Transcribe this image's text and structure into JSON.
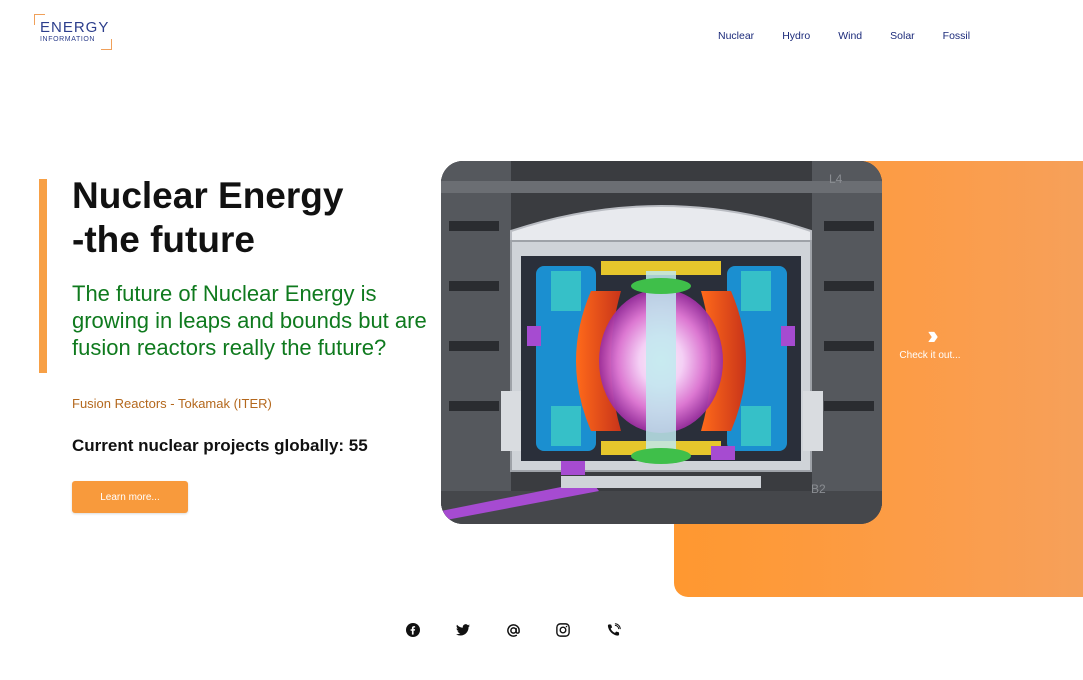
{
  "brand": {
    "line1": "ENERGY",
    "line2": "INFORMATION",
    "accent": "#f0a05a",
    "color": "#2c3e8c"
  },
  "nav": {
    "items": [
      "Nuclear",
      "Hydro",
      "Wind",
      "Solar",
      "Fossil"
    ]
  },
  "hero": {
    "title_line1": "Nuclear Energy",
    "title_line2": "-the future",
    "lead": "The future of Nuclear Energy is growing in leaps and bounds but are fusion reactors really the future?",
    "caption": "Fusion Reactors - Tokamak (ITER)",
    "projects_label": "Current nuclear projects globally: 55",
    "cta": "Learn more...",
    "check_label": "Check it out...",
    "check_icon": "double-chevron-right-icon"
  },
  "image": {
    "tag_top": "L4",
    "tag_bottom": "B2"
  },
  "colors": {
    "accent_orange": "#f89a3c",
    "lead_green": "#0f7a1e",
    "caption_brown": "#b4681d",
    "nav_blue": "#1b2a7a"
  },
  "social": [
    "facebook-icon",
    "twitter-icon",
    "at-sign-icon",
    "instagram-icon",
    "phone-icon"
  ]
}
